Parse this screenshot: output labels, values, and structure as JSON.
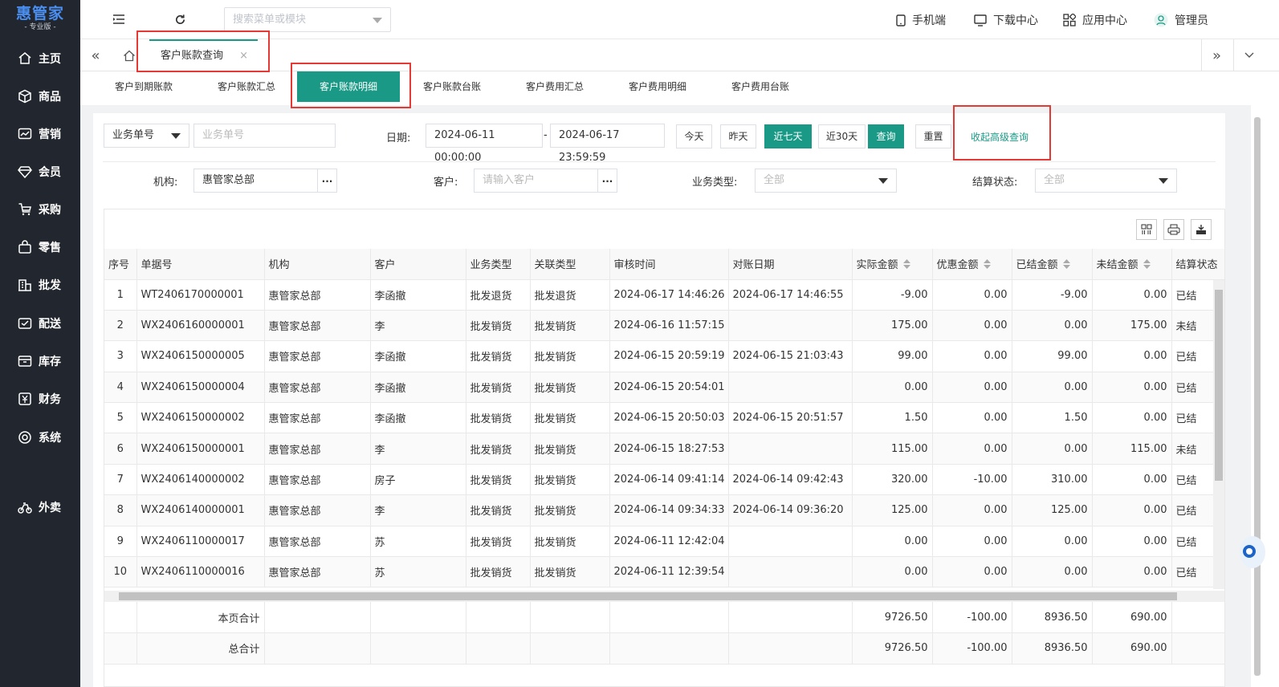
{
  "app": {
    "logo_main": "惠管家",
    "logo_sub": "- 专业版 -"
  },
  "sidebar": {
    "items": [
      {
        "label": "主页",
        "icon": "home-icon"
      },
      {
        "label": "商品",
        "icon": "cube-icon"
      },
      {
        "label": "营销",
        "icon": "chart-icon"
      },
      {
        "label": "会员",
        "icon": "diamond-icon"
      },
      {
        "label": "采购",
        "icon": "cart-icon"
      },
      {
        "label": "零售",
        "icon": "bag-icon"
      },
      {
        "label": "批发",
        "icon": "building-icon"
      },
      {
        "label": "配送",
        "icon": "truck-icon"
      },
      {
        "label": "库存",
        "icon": "box-icon"
      },
      {
        "label": "财务",
        "icon": "yen-icon"
      },
      {
        "label": "系统",
        "icon": "gear-icon"
      },
      {
        "label": "外卖",
        "icon": "bike-icon"
      }
    ]
  },
  "topbar": {
    "search_placeholder": "搜索菜单或模块",
    "mobile": "手机端",
    "download": "下载中心",
    "apps": "应用中心",
    "user": "管理员"
  },
  "tabs": {
    "active": "客户账款查询",
    "close": "×"
  },
  "subtabs": [
    "客户到期账款",
    "客户账款汇总",
    "客户账款明细",
    "客户账款台账",
    "客户费用汇总",
    "客户费用明细",
    "客户费用台账"
  ],
  "filters": {
    "field_select": "业务单号",
    "field_placeholder": "业务单号",
    "date_label": "日期:",
    "date_from": "2024-06-11 00:00:00",
    "date_sep": "-",
    "date_to": "2024-06-17 23:59:59",
    "btn_today": "今天",
    "btn_yesterday": "昨天",
    "btn_7days": "近七天",
    "btn_30days": "近30天",
    "btn_query": "查询",
    "btn_reset": "重置",
    "link_advanced": "收起高级查询",
    "org_label": "机构:",
    "org_value": "惠管家总部",
    "customer_label": "客户:",
    "customer_placeholder": "请输入客户",
    "biz_type_label": "业务类型:",
    "biz_type_value": "全部",
    "settle_label": "结算状态:",
    "settle_value": "全部",
    "dots": "..."
  },
  "grid": {
    "columns": [
      "序号",
      "单据号",
      "机构",
      "客户",
      "业务类型",
      "关联类型",
      "审核时间",
      "对账日期",
      "实际金额",
      "优惠金额",
      "已结金额",
      "未结金额",
      "结算状态"
    ],
    "rows": [
      [
        "1",
        "WT2406170000001",
        "惠管家总部",
        "李函撤",
        "批发退货",
        "批发退货",
        "2024-06-17 14:46:26",
        "2024-06-17 14:46:55",
        "-9.00",
        "0.00",
        "-9.00",
        "0.00",
        "已结"
      ],
      [
        "2",
        "WX2406160000001",
        "惠管家总部",
        "李",
        "批发销货",
        "批发销货",
        "2024-06-16 11:57:15",
        "",
        "175.00",
        "0.00",
        "0.00",
        "175.00",
        "未结"
      ],
      [
        "3",
        "WX2406150000005",
        "惠管家总部",
        "李函撤",
        "批发销货",
        "批发销货",
        "2024-06-15 20:59:19",
        "2024-06-15 21:03:43",
        "99.00",
        "0.00",
        "99.00",
        "0.00",
        "已结"
      ],
      [
        "4",
        "WX2406150000004",
        "惠管家总部",
        "李函撤",
        "批发销货",
        "批发销货",
        "2024-06-15 20:54:01",
        "",
        "0.00",
        "0.00",
        "0.00",
        "0.00",
        "已结"
      ],
      [
        "5",
        "WX2406150000002",
        "惠管家总部",
        "李函撤",
        "批发销货",
        "批发销货",
        "2024-06-15 20:50:03",
        "2024-06-15 20:51:57",
        "1.50",
        "0.00",
        "1.50",
        "0.00",
        "已结"
      ],
      [
        "6",
        "WX2406150000001",
        "惠管家总部",
        "李",
        "批发销货",
        "批发销货",
        "2024-06-15 18:27:53",
        "",
        "115.00",
        "0.00",
        "0.00",
        "115.00",
        "未结"
      ],
      [
        "7",
        "WX2406140000002",
        "惠管家总部",
        "房子",
        "批发销货",
        "批发销货",
        "2024-06-14 09:41:14",
        "2024-06-14 09:42:43",
        "320.00",
        "-10.00",
        "310.00",
        "0.00",
        "已结"
      ],
      [
        "8",
        "WX2406140000001",
        "惠管家总部",
        "李",
        "批发销货",
        "批发销货",
        "2024-06-14 09:34:33",
        "2024-06-14 09:36:20",
        "125.00",
        "0.00",
        "125.00",
        "0.00",
        "已结"
      ],
      [
        "9",
        "WX2406110000017",
        "惠管家总部",
        "苏",
        "批发销货",
        "批发销货",
        "2024-06-11 12:42:04",
        "",
        "0.00",
        "0.00",
        "0.00",
        "0.00",
        "已结"
      ],
      [
        "10",
        "WX2406110000016",
        "惠管家总部",
        "苏",
        "批发销货",
        "批发销货",
        "2024-06-11 12:39:54",
        "",
        "0.00",
        "0.00",
        "0.00",
        "0.00",
        "已结"
      ]
    ],
    "footer": [
      {
        "label": "本页合计",
        "actual": "9726.50",
        "discount": "-100.00",
        "settled": "8936.50",
        "unsettled": "690.00"
      },
      {
        "label": "总合计",
        "actual": "9726.50",
        "discount": "-100.00",
        "settled": "8936.50",
        "unsettled": "690.00"
      }
    ]
  },
  "colors": {
    "accent": "#1a9a86",
    "sidebar": "#22262e",
    "highlight": "#e53935"
  }
}
